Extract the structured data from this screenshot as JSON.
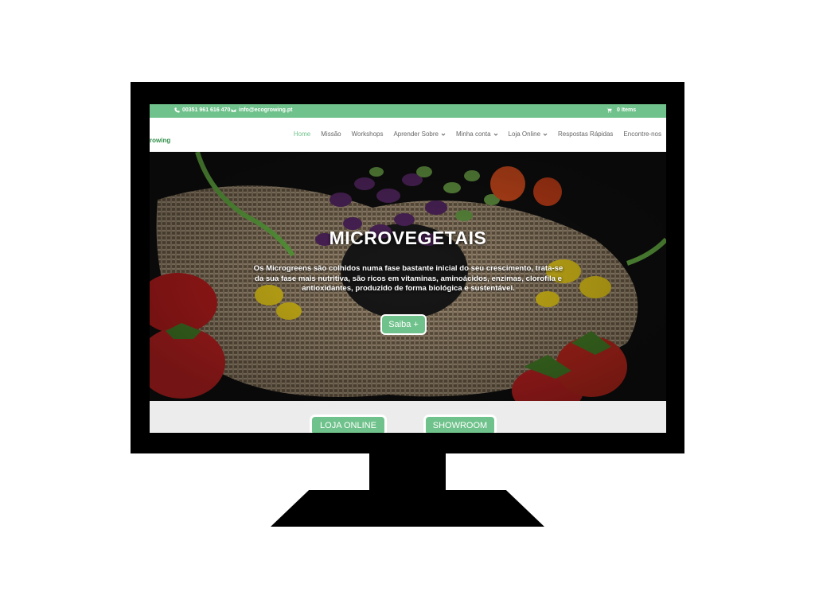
{
  "topbar": {
    "phone": "00351 961 616 470",
    "email": "info@ecogrowing.pt",
    "cart": "0 Items"
  },
  "header": {
    "logo": "rowing"
  },
  "nav": {
    "items": [
      {
        "label": "Home",
        "active": true
      },
      {
        "label": "Missão"
      },
      {
        "label": "Workshops"
      },
      {
        "label": "Aprender Sobre",
        "has_dropdown": true
      },
      {
        "label": "Minha conta",
        "has_dropdown": true
      },
      {
        "label": "Loja Online",
        "has_dropdown": true
      },
      {
        "label": "Respostas Rápidas"
      },
      {
        "label": "Encontre-nos"
      }
    ]
  },
  "hero": {
    "title": "MICROVEGETAIS",
    "text": "Os Microgreens são colhidos numa fase bastante inicial do seu crescimento, trata-se da sua fase mais nutritiva, são ricos em vitaminas, aminoácidos, enzimas, clorofila e antioxidantes, produzido de forma biológica e sustentável.",
    "button": "Saiba +"
  },
  "buttons": {
    "shop": "LOJA ONLINE",
    "showroom": "SHOWROOM"
  },
  "colors": {
    "accent": "#6fc28b",
    "logo": "#2f8f48",
    "frame": "#000000",
    "strip": "#ececec"
  }
}
